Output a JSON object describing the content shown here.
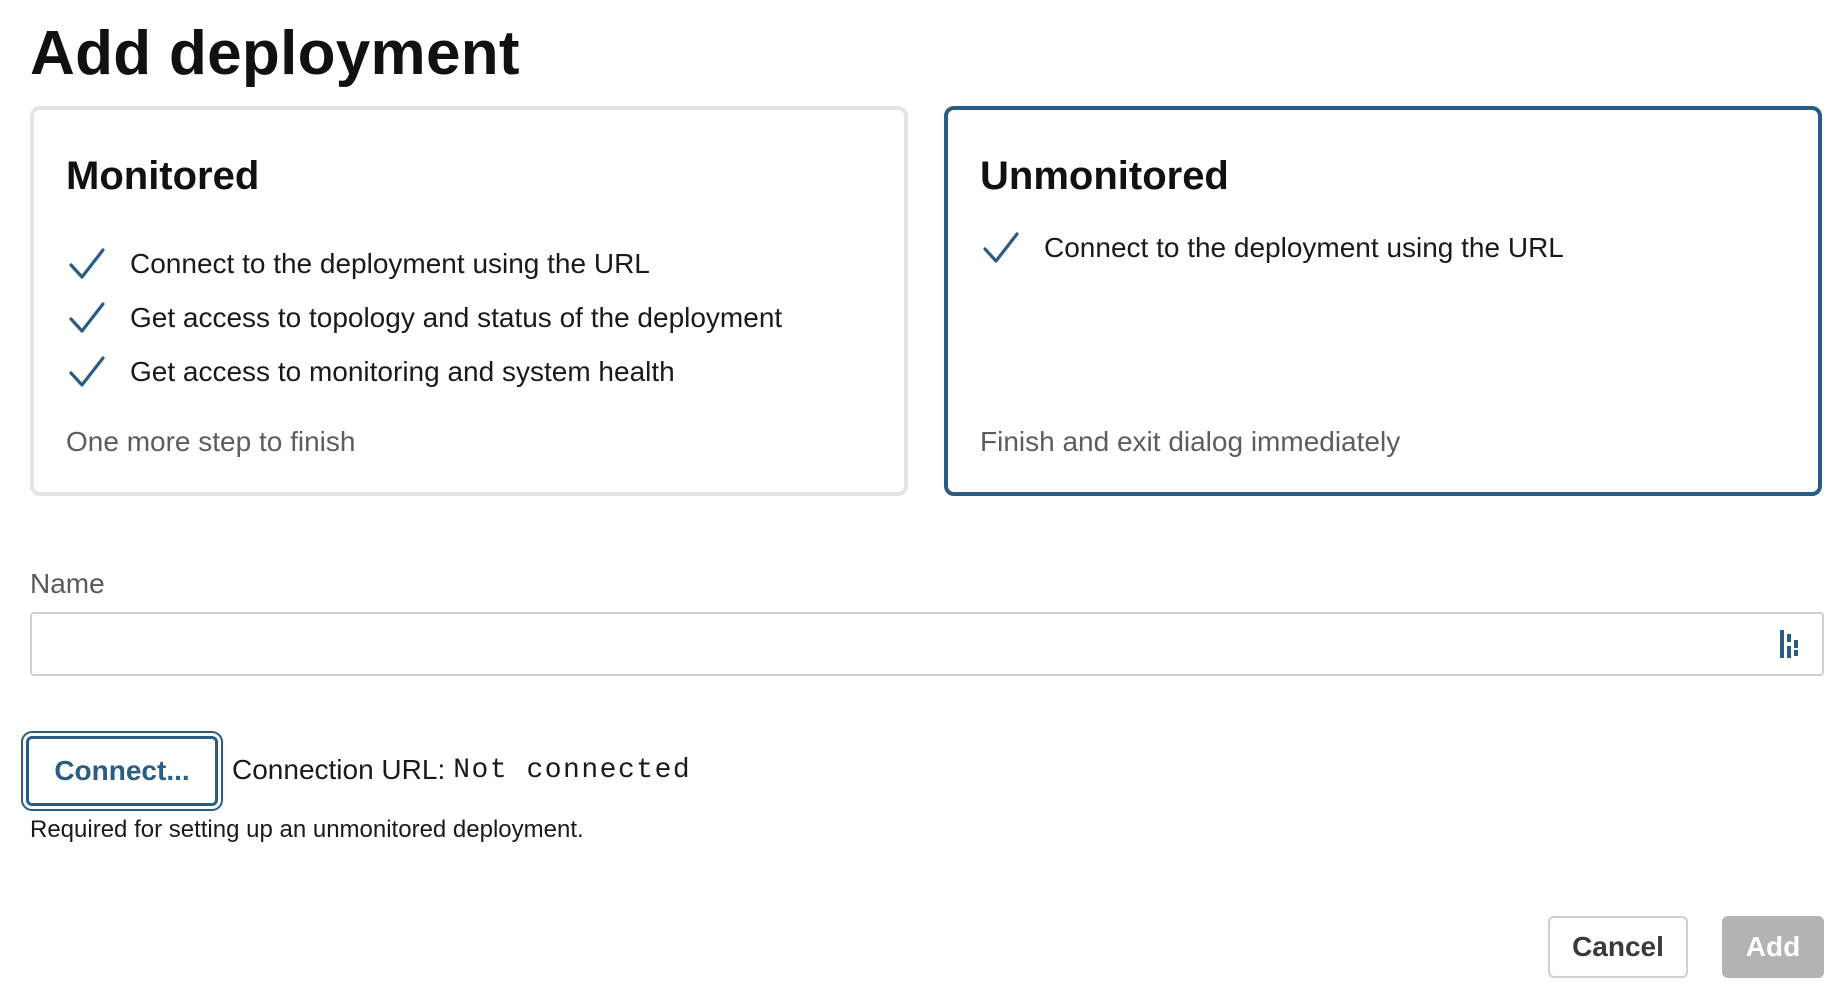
{
  "dialog": {
    "title": "Add deployment"
  },
  "options": {
    "monitored": {
      "title": "Monitored",
      "features": [
        "Connect to the deployment using the URL",
        "Get access to topology and status of the deployment",
        "Get access to monitoring and system health"
      ],
      "note": "One more step to finish",
      "selected": false
    },
    "unmonitored": {
      "title": "Unmonitored",
      "features": [
        "Connect to the deployment using the URL"
      ],
      "note": "Finish and exit dialog immediately",
      "selected": true
    }
  },
  "name_field": {
    "label": "Name",
    "value": "",
    "placeholder": ""
  },
  "connection": {
    "button_label": "Connect...",
    "url_label": "Connection URL:",
    "url_value": "Not connected",
    "help_text": "Required for setting up an unmonitored deployment."
  },
  "actions": {
    "cancel_label": "Cancel",
    "add_label": "Add",
    "add_disabled": true
  },
  "icons": {
    "feature": "checkmark-icon",
    "input_addon": "password-manager-icon"
  },
  "colors": {
    "accent": "#2b5c82",
    "card_border": "#e4e4e4",
    "disabled_button": "#b3b3b3",
    "muted_text": "#5d5d5d"
  }
}
